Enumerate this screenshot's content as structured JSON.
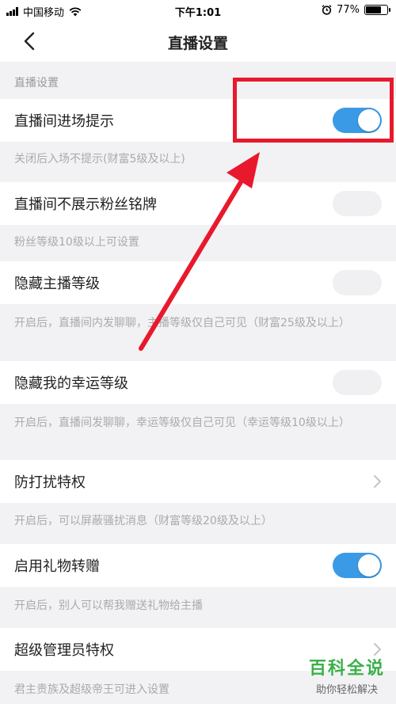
{
  "status_bar": {
    "carrier": "中国移动",
    "time": "下午1:01",
    "battery": "77%",
    "battery_level": 0.77,
    "icons": [
      "signal-icon",
      "wifi-icon",
      "alarm-icon",
      "battery-icon"
    ]
  },
  "header": {
    "title": "直播设置",
    "back_icon": "chevron-left-icon"
  },
  "section": {
    "title": "直播设置"
  },
  "settings": [
    {
      "label": "直播间进场提示",
      "control": "toggle",
      "on": true,
      "desc": "关闭后入场不提示(财富5级及以上)"
    },
    {
      "label": "直播间不展示粉丝铭牌",
      "control": "toggle",
      "on": false,
      "desc": "粉丝等级10级以上可设置"
    },
    {
      "label": "隐藏主播等级",
      "control": "toggle",
      "on": false,
      "desc": "开启后，直播间内发聊聊，主播等级仅自己可见（财富25级及以上）"
    },
    {
      "label": "隐藏我的幸运等级",
      "control": "toggle",
      "on": false,
      "desc": "开启后，直播间发聊聊，幸运等级仅自己可见（幸运等级10级以上）"
    },
    {
      "label": "防打扰特权",
      "control": "chevron",
      "desc": "开启后，可以屏蔽骚扰消息（财富等级20级及以上）"
    },
    {
      "label": "启用礼物转赠",
      "control": "toggle",
      "on": true,
      "desc": "开启后，别人可以帮我赠送礼物给主播"
    },
    {
      "label": "超级管理员特权",
      "control": "chevron",
      "desc": "君主贵族及超级帝王可进入设置"
    }
  ],
  "watermark": {
    "brand": "百科全说",
    "slogan": "助你轻松解决"
  },
  "colors": {
    "accent_toggle": "#3a9ae6",
    "annotation_red": "#e8192c",
    "watermark_green": "#3bb04a",
    "page_bg": "#f2f2f4"
  }
}
